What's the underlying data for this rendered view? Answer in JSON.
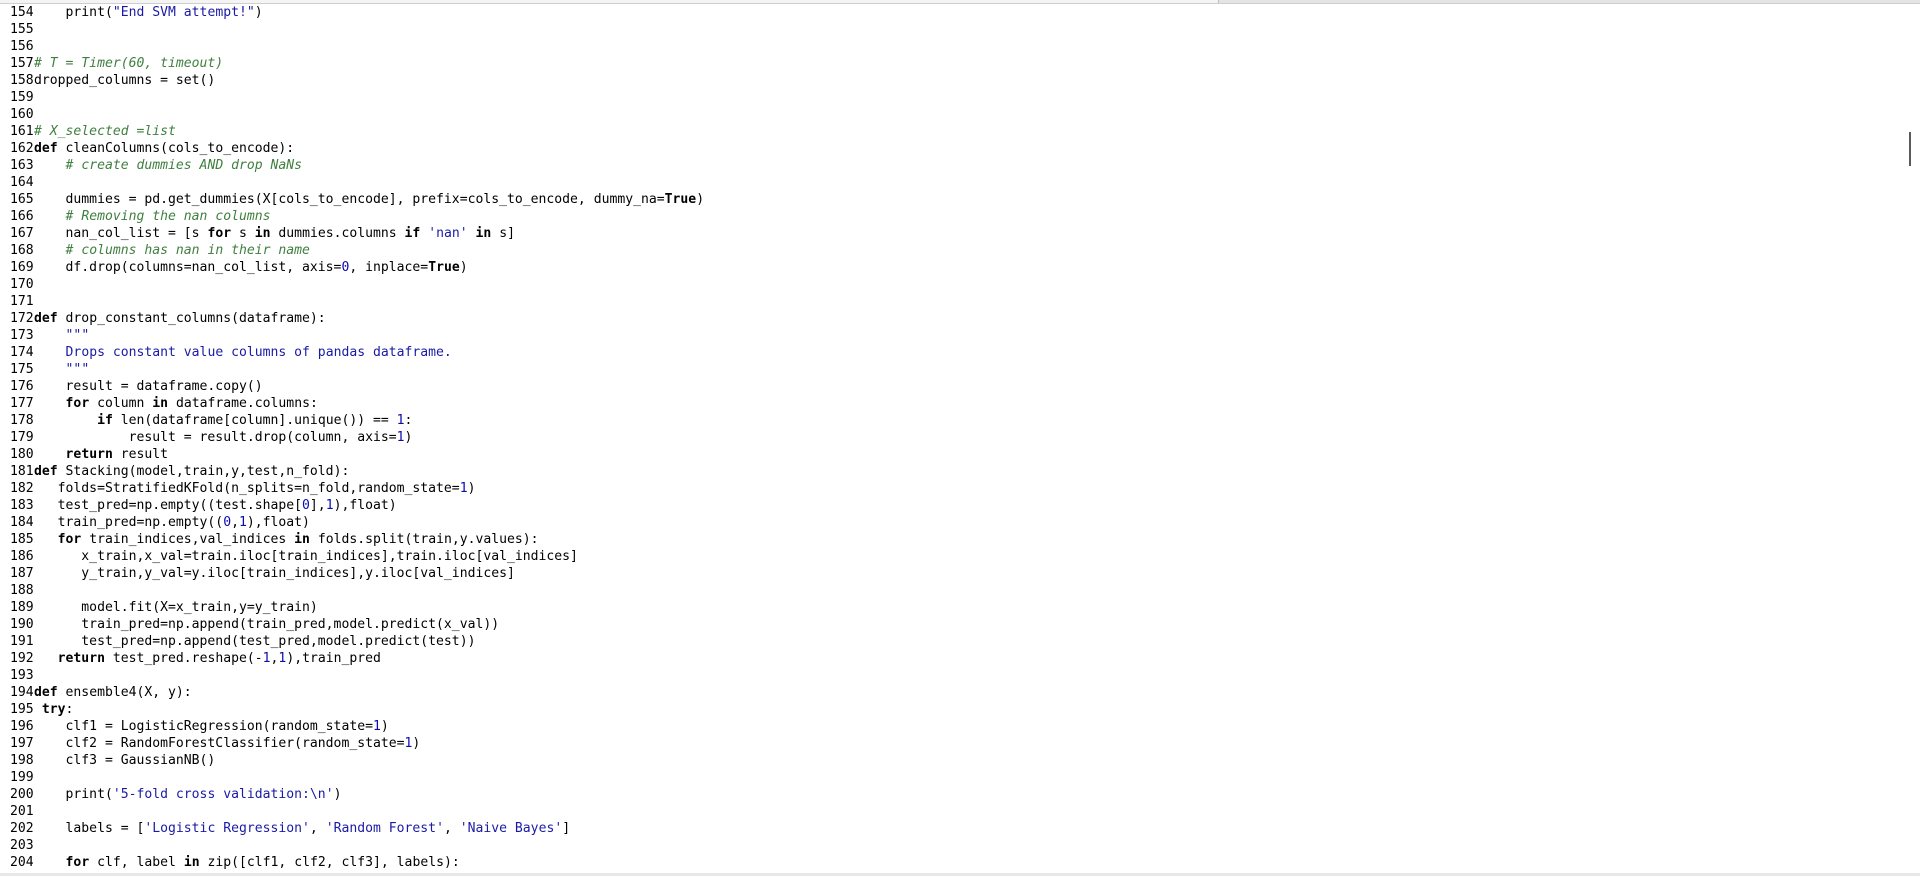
{
  "editor": {
    "lines": [
      {
        "num": "154",
        "tokens": [
          {
            "t": "    print(",
            "c": "tx"
          },
          {
            "t": "\"End SVM attempt!\"",
            "c": "st"
          },
          {
            "t": ")",
            "c": "tx"
          }
        ]
      },
      {
        "num": "155",
        "tokens": []
      },
      {
        "num": "156",
        "tokens": []
      },
      {
        "num": "157",
        "tokens": [
          {
            "t": "# T = Timer(60, timeout)",
            "c": "cm"
          }
        ]
      },
      {
        "num": "158",
        "tokens": [
          {
            "t": "dropped_columns = set()",
            "c": "tx"
          }
        ]
      },
      {
        "num": "159",
        "tokens": []
      },
      {
        "num": "160",
        "tokens": []
      },
      {
        "num": "161",
        "tokens": [
          {
            "t": "# X_selected =list",
            "c": "cm"
          }
        ]
      },
      {
        "num": "162",
        "tokens": [
          {
            "t": "def",
            "c": "kw"
          },
          {
            "t": " cleanColumns(cols_to_encode):",
            "c": "tx"
          }
        ]
      },
      {
        "num": "163",
        "tokens": [
          {
            "t": "    ",
            "c": "tx"
          },
          {
            "t": "# create dummies AND drop NaNs",
            "c": "cm"
          }
        ]
      },
      {
        "num": "164",
        "tokens": []
      },
      {
        "num": "165",
        "tokens": [
          {
            "t": "    dummies = pd.get_dummies(X[cols_to_encode], prefix=cols_to_encode, dummy_na=",
            "c": "tx"
          },
          {
            "t": "True",
            "c": "kw"
          },
          {
            "t": ")",
            "c": "tx"
          }
        ]
      },
      {
        "num": "166",
        "tokens": [
          {
            "t": "    ",
            "c": "tx"
          },
          {
            "t": "# Removing the nan columns",
            "c": "cm"
          }
        ]
      },
      {
        "num": "167",
        "tokens": [
          {
            "t": "    nan_col_list = [s ",
            "c": "tx"
          },
          {
            "t": "for",
            "c": "kw"
          },
          {
            "t": " s ",
            "c": "tx"
          },
          {
            "t": "in",
            "c": "kw"
          },
          {
            "t": " dummies.columns ",
            "c": "tx"
          },
          {
            "t": "if",
            "c": "kw"
          },
          {
            "t": " ",
            "c": "tx"
          },
          {
            "t": "'nan'",
            "c": "st"
          },
          {
            "t": " ",
            "c": "tx"
          },
          {
            "t": "in",
            "c": "kw"
          },
          {
            "t": " s]",
            "c": "tx"
          }
        ]
      },
      {
        "num": "168",
        "tokens": [
          {
            "t": "    ",
            "c": "tx"
          },
          {
            "t": "# columns has nan in their name",
            "c": "cm"
          }
        ]
      },
      {
        "num": "169",
        "tokens": [
          {
            "t": "    df.drop(columns=nan_col_list, axis=",
            "c": "tx"
          },
          {
            "t": "0",
            "c": "nm"
          },
          {
            "t": ", inplace=",
            "c": "tx"
          },
          {
            "t": "True",
            "c": "kw"
          },
          {
            "t": ")",
            "c": "tx"
          }
        ]
      },
      {
        "num": "170",
        "tokens": []
      },
      {
        "num": "171",
        "tokens": []
      },
      {
        "num": "172",
        "tokens": [
          {
            "t": "def",
            "c": "kw"
          },
          {
            "t": " drop_constant_columns(dataframe):",
            "c": "tx"
          }
        ]
      },
      {
        "num": "173",
        "tokens": [
          {
            "t": "    ",
            "c": "tx"
          },
          {
            "t": "\"\"\"",
            "c": "st"
          }
        ]
      },
      {
        "num": "174",
        "tokens": [
          {
            "t": "    ",
            "c": "tx"
          },
          {
            "t": "Drops constant value columns of pandas dataframe.",
            "c": "st"
          }
        ]
      },
      {
        "num": "175",
        "tokens": [
          {
            "t": "    ",
            "c": "tx"
          },
          {
            "t": "\"\"\"",
            "c": "st"
          }
        ]
      },
      {
        "num": "176",
        "tokens": [
          {
            "t": "    result = dataframe.copy()",
            "c": "tx"
          }
        ]
      },
      {
        "num": "177",
        "tokens": [
          {
            "t": "    ",
            "c": "tx"
          },
          {
            "t": "for",
            "c": "kw"
          },
          {
            "t": " column ",
            "c": "tx"
          },
          {
            "t": "in",
            "c": "kw"
          },
          {
            "t": " dataframe.columns:",
            "c": "tx"
          }
        ]
      },
      {
        "num": "178",
        "tokens": [
          {
            "t": "        ",
            "c": "tx"
          },
          {
            "t": "if",
            "c": "kw"
          },
          {
            "t": " len(dataframe[column].unique()) == ",
            "c": "tx"
          },
          {
            "t": "1",
            "c": "nm"
          },
          {
            "t": ":",
            "c": "tx"
          }
        ]
      },
      {
        "num": "179",
        "tokens": [
          {
            "t": "            result = result.drop(column, axis=",
            "c": "tx"
          },
          {
            "t": "1",
            "c": "nm"
          },
          {
            "t": ")",
            "c": "tx"
          }
        ]
      },
      {
        "num": "180",
        "tokens": [
          {
            "t": "    ",
            "c": "tx"
          },
          {
            "t": "return",
            "c": "kw"
          },
          {
            "t": " result",
            "c": "tx"
          }
        ]
      },
      {
        "num": "181",
        "tokens": [
          {
            "t": "def",
            "c": "kw"
          },
          {
            "t": " Stacking(model,train,y,test,n_fold):",
            "c": "tx"
          }
        ]
      },
      {
        "num": "182",
        "tokens": [
          {
            "t": "   folds=StratifiedKFold(n_splits=n_fold,random_state=",
            "c": "tx"
          },
          {
            "t": "1",
            "c": "nm"
          },
          {
            "t": ")",
            "c": "tx"
          }
        ]
      },
      {
        "num": "183",
        "tokens": [
          {
            "t": "   test_pred=np.empty((test.shape[",
            "c": "tx"
          },
          {
            "t": "0",
            "c": "nm"
          },
          {
            "t": "],",
            "c": "tx"
          },
          {
            "t": "1",
            "c": "nm"
          },
          {
            "t": "),float)",
            "c": "tx"
          }
        ]
      },
      {
        "num": "184",
        "tokens": [
          {
            "t": "   train_pred=np.empty((",
            "c": "tx"
          },
          {
            "t": "0",
            "c": "nm"
          },
          {
            "t": ",",
            "c": "tx"
          },
          {
            "t": "1",
            "c": "nm"
          },
          {
            "t": "),float)",
            "c": "tx"
          }
        ]
      },
      {
        "num": "185",
        "tokens": [
          {
            "t": "   ",
            "c": "tx"
          },
          {
            "t": "for",
            "c": "kw"
          },
          {
            "t": " train_indices,val_indices ",
            "c": "tx"
          },
          {
            "t": "in",
            "c": "kw"
          },
          {
            "t": " folds.split(train,y.values):",
            "c": "tx"
          }
        ]
      },
      {
        "num": "186",
        "tokens": [
          {
            "t": "      x_train,x_val=train.iloc[train_indices],train.iloc[val_indices]",
            "c": "tx"
          }
        ]
      },
      {
        "num": "187",
        "tokens": [
          {
            "t": "      y_train,y_val=y.iloc[train_indices],y.iloc[val_indices]",
            "c": "tx"
          }
        ]
      },
      {
        "num": "188",
        "tokens": []
      },
      {
        "num": "189",
        "tokens": [
          {
            "t": "      model.fit(X=x_train,y=y_train)",
            "c": "tx"
          }
        ]
      },
      {
        "num": "190",
        "tokens": [
          {
            "t": "      train_pred=np.append(train_pred,model.predict(x_val))",
            "c": "tx"
          }
        ]
      },
      {
        "num": "191",
        "tokens": [
          {
            "t": "      test_pred=np.append(test_pred,model.predict(test))",
            "c": "tx"
          }
        ]
      },
      {
        "num": "192",
        "tokens": [
          {
            "t": "   ",
            "c": "tx"
          },
          {
            "t": "return",
            "c": "kw"
          },
          {
            "t": " test_pred.reshape(-",
            "c": "tx"
          },
          {
            "t": "1",
            "c": "nm"
          },
          {
            "t": ",",
            "c": "tx"
          },
          {
            "t": "1",
            "c": "nm"
          },
          {
            "t": "),train_pred",
            "c": "tx"
          }
        ]
      },
      {
        "num": "193",
        "tokens": []
      },
      {
        "num": "194",
        "tokens": [
          {
            "t": "def",
            "c": "kw"
          },
          {
            "t": " ensemble4(X, y):",
            "c": "tx"
          }
        ]
      },
      {
        "num": "195",
        "tokens": [
          {
            "t": " ",
            "c": "tx"
          },
          {
            "t": "try",
            "c": "kw"
          },
          {
            "t": ":",
            "c": "tx"
          }
        ]
      },
      {
        "num": "196",
        "tokens": [
          {
            "t": "    clf1 = LogisticRegression(random_state=",
            "c": "tx"
          },
          {
            "t": "1",
            "c": "nm"
          },
          {
            "t": ")",
            "c": "tx"
          }
        ]
      },
      {
        "num": "197",
        "tokens": [
          {
            "t": "    clf2 = RandomForestClassifier(random_state=",
            "c": "tx"
          },
          {
            "t": "1",
            "c": "nm"
          },
          {
            "t": ")",
            "c": "tx"
          }
        ]
      },
      {
        "num": "198",
        "tokens": [
          {
            "t": "    clf3 = GaussianNB()",
            "c": "tx"
          }
        ]
      },
      {
        "num": "199",
        "tokens": []
      },
      {
        "num": "200",
        "tokens": [
          {
            "t": "    print(",
            "c": "tx"
          },
          {
            "t": "'5-fold cross validation:\\n'",
            "c": "st"
          },
          {
            "t": ")",
            "c": "tx"
          }
        ]
      },
      {
        "num": "201",
        "tokens": []
      },
      {
        "num": "202",
        "tokens": [
          {
            "t": "    labels = [",
            "c": "tx"
          },
          {
            "t": "'Logistic Regression'",
            "c": "st"
          },
          {
            "t": ", ",
            "c": "tx"
          },
          {
            "t": "'Random Forest'",
            "c": "st"
          },
          {
            "t": ", ",
            "c": "tx"
          },
          {
            "t": "'Naive Bayes'",
            "c": "st"
          },
          {
            "t": "]",
            "c": "tx"
          }
        ]
      },
      {
        "num": "203",
        "tokens": []
      },
      {
        "num": "204",
        "tokens": [
          {
            "t": "    ",
            "c": "tx"
          },
          {
            "t": "for",
            "c": "kw"
          },
          {
            "t": " clf, label ",
            "c": "tx"
          },
          {
            "t": "in",
            "c": "kw"
          },
          {
            "t": " zip([clf1, clf2, clf3], labels):",
            "c": "tx"
          }
        ]
      }
    ]
  }
}
